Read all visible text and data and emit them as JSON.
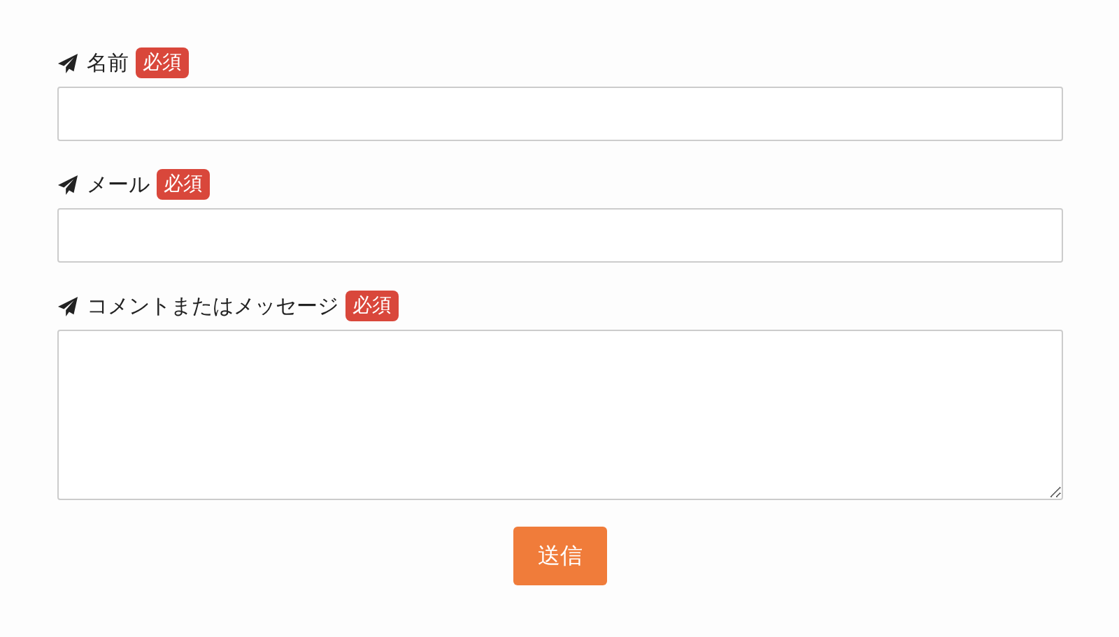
{
  "fields": [
    {
      "kind": "input",
      "label": "名前",
      "badge": "必須"
    },
    {
      "kind": "input",
      "label": "メール",
      "badge": "必須"
    },
    {
      "kind": "textarea",
      "label": "コメントまたはメッセージ",
      "badge": "必須"
    }
  ],
  "submit": {
    "label": "送信"
  }
}
